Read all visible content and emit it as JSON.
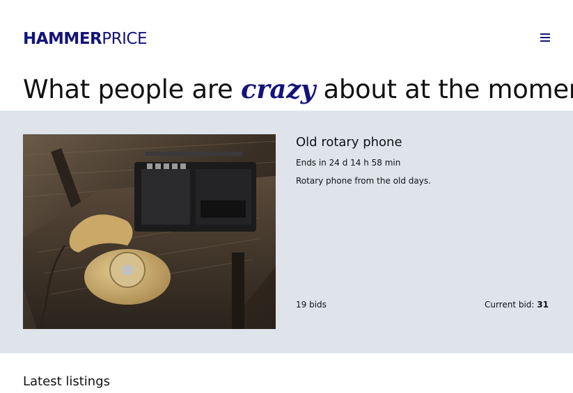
{
  "header": {
    "logo_bold": "HAMMER",
    "logo_light": "PRICE",
    "menu_icon": "hamburger-menu-icon"
  },
  "hero": {
    "headline_before": "What people are",
    "headline_accent": "crazy",
    "headline_after": "about at the moment"
  },
  "featured": {
    "title": "Old rotary phone",
    "ends": "Ends in 24 d 14 h 58 min",
    "description": "Rotary phone from the old days.",
    "bids": "19 bids",
    "current_bid_label": "Current bid:",
    "current_bid_value": "31",
    "image_subject": "rotary telephone and cassette radio on a wooden table"
  },
  "latest": {
    "title": "Latest listings"
  },
  "colors": {
    "brand": "#14137a",
    "featured_bg": "#dfe4eb",
    "text": "#111111"
  }
}
